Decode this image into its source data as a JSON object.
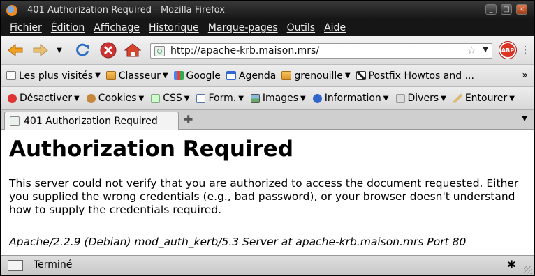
{
  "window": {
    "title": "401 Authorization Required - Mozilla Firefox",
    "controls": [
      "_",
      "□",
      "×"
    ]
  },
  "menu": [
    "Fichier",
    "Édition",
    "Affichage",
    "Historique",
    "Marque-pages",
    "Outils",
    "Aide"
  ],
  "nav": {
    "url": "http://apache-krb.maison.mrs/",
    "back": "←",
    "forward": "→",
    "dropdown": "▼",
    "reload": "↻",
    "stop": "✕",
    "home": "⌂",
    "star": "☆",
    "url_dropdown": "▼",
    "adblock": "ABP",
    "resizer": "⠿"
  },
  "bookmarks": [
    {
      "label": "Les plus visités",
      "arrow": "▼",
      "icon": "folder"
    },
    {
      "label": "Classeur",
      "arrow": "▼",
      "icon": "folder"
    },
    {
      "label": "Google",
      "arrow": "",
      "icon": "google"
    },
    {
      "label": "Agenda",
      "arrow": "",
      "icon": "calendar"
    },
    {
      "label": "grenouille",
      "arrow": "▼",
      "icon": "folder"
    },
    {
      "label": "Postfix Howtos and ...",
      "arrow": "",
      "icon": "postfix"
    }
  ],
  "bookmarks_more": "»",
  "webdev": [
    {
      "label": "Désactiver",
      "arrow": "▼",
      "color": "#d33"
    },
    {
      "label": "Cookies",
      "arrow": "▼",
      "color": "#c7873a"
    },
    {
      "label": "CSS",
      "arrow": "▼",
      "color": "#8a8"
    },
    {
      "label": "Form.",
      "arrow": "▼",
      "color": "#57a"
    },
    {
      "label": "Images",
      "arrow": "▼",
      "color": "#6a6"
    },
    {
      "label": "Information",
      "arrow": "▼",
      "color": "#36c"
    },
    {
      "label": "Divers",
      "arrow": "▼",
      "color": "#aaa"
    },
    {
      "label": "Entourer",
      "arrow": "▼",
      "color": "#db7"
    }
  ],
  "tab": {
    "label": "401 Authorization Required",
    "new_tab": "✚",
    "list": "▼"
  },
  "page": {
    "heading": "Authorization Required",
    "body": "This server could not verify that you are authorized to access the document requested. Either you supplied the wrong credentials (e.g., bad password), or your browser doesn't understand how to supply the credentials required.",
    "signature": "Apache/2.2.9 (Debian) mod_auth_kerb/5.3 Server at apache-krb.maison.mrs Port 80"
  },
  "status": {
    "text": "Terminé",
    "bug": "✱"
  }
}
